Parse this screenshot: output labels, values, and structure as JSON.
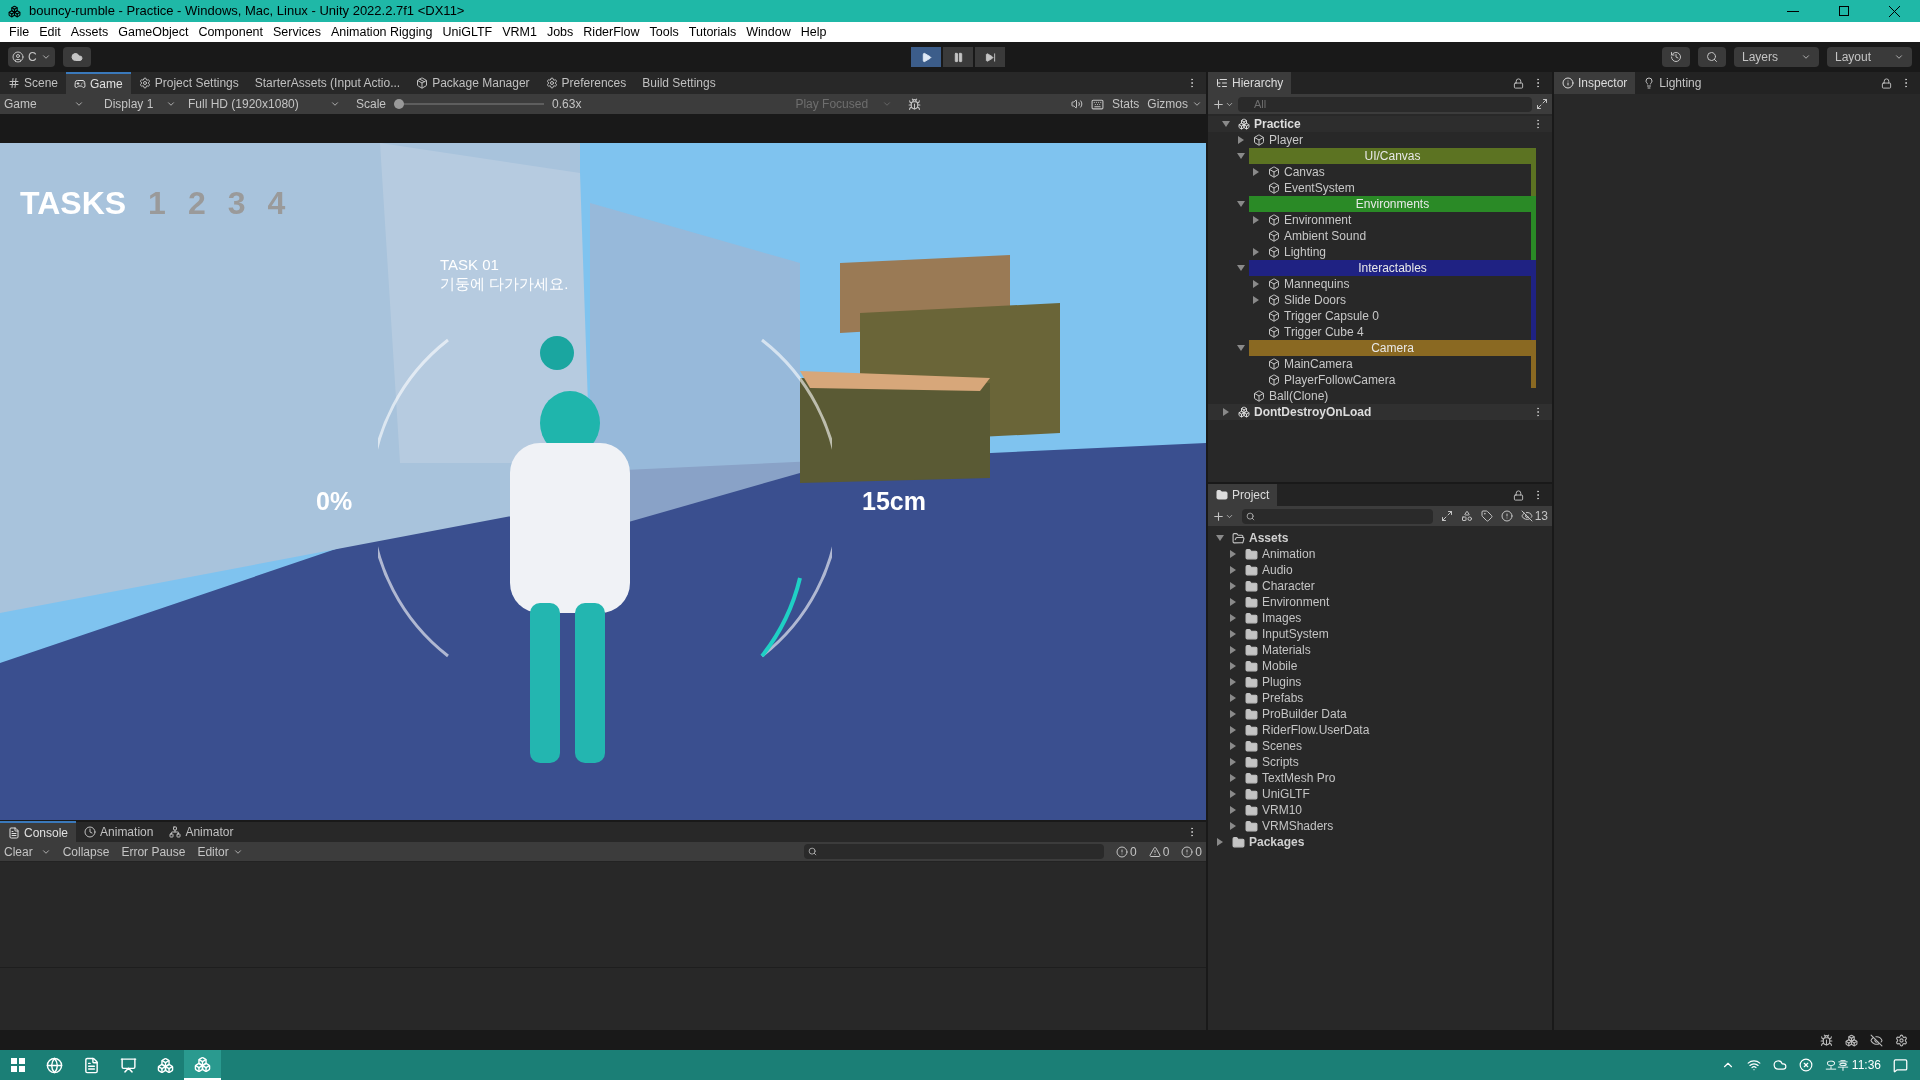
{
  "window": {
    "title": "bouncy-rumble - Practice - Windows, Mac, Linux - Unity 2022.2.7f1 <DX11>"
  },
  "menu": [
    "File",
    "Edit",
    "Assets",
    "GameObject",
    "Component",
    "Services",
    "Animation Rigging",
    "UniGLTF",
    "VRM1",
    "Jobs",
    "RiderFlow",
    "Tools",
    "Tutorials",
    "Window",
    "Help"
  ],
  "toolbar": {
    "account": "C",
    "play": [
      {
        "kind": "play",
        "on": true
      },
      {
        "kind": "pause",
        "on": false
      },
      {
        "kind": "step",
        "on": false
      }
    ],
    "layers": "Layers",
    "layout": "Layout"
  },
  "main_tabs": [
    {
      "label": "Scene",
      "selected": false
    },
    {
      "label": "Game",
      "selected": true
    },
    {
      "label": "Project Settings",
      "selected": false
    },
    {
      "label": "StarterAssets (Input Actio...",
      "selected": false
    },
    {
      "label": "Package Manager",
      "selected": false
    },
    {
      "label": "Preferences",
      "selected": false
    },
    {
      "label": "Build Settings",
      "selected": false
    }
  ],
  "game_toolbar": {
    "view": "Game",
    "display": "Display 1",
    "resolution": "Full HD (1920x1080)",
    "scale_label": "Scale",
    "scale": {
      "level": 0.0
    },
    "scale_value": "0.63x",
    "play_mode": {
      "label": "Play Focused",
      "disabled": true
    },
    "stats": "Stats",
    "gizmos": "Gizmos"
  },
  "game_hud": {
    "tasks_title": "TASKS",
    "tasks": [
      "1",
      "2",
      "3",
      "4"
    ],
    "task_heading": "TASK 01",
    "task_text": "기둥에 다가가세요.",
    "left_reading": "0%",
    "right_reading": "15cm"
  },
  "hierarchy": {
    "tab": "Hierarchy",
    "search_placeholder": "All",
    "items": [
      {
        "kind": "scene",
        "name": "Practice",
        "expanded": true,
        "children": [
          {
            "kind": "object",
            "name": "Player",
            "expanded": false
          },
          {
            "kind": "header",
            "name": "UI/Canvas",
            "color": "#5c7322",
            "expanded": true,
            "children": [
              {
                "kind": "object",
                "name": "Canvas",
                "expanded": false
              },
              {
                "kind": "object",
                "name": "EventSystem"
              }
            ]
          },
          {
            "kind": "header",
            "name": "Environments",
            "color": "#2a8a26",
            "expanded": true,
            "children": [
              {
                "kind": "object",
                "name": "Environment",
                "expanded": false
              },
              {
                "kind": "object",
                "name": "Ambient Sound"
              },
              {
                "kind": "object",
                "name": "Lighting",
                "expanded": false
              }
            ]
          },
          {
            "kind": "header",
            "name": "Interactables",
            "color": "#1f2283",
            "expanded": true,
            "children": [
              {
                "kind": "object",
                "name": "Mannequins",
                "expanded": false
              },
              {
                "kind": "object",
                "name": "Slide Doors",
                "expanded": false
              },
              {
                "kind": "object",
                "name": "Trigger Capsule 0"
              },
              {
                "kind": "object",
                "name": "Trigger Cube 4"
              }
            ]
          },
          {
            "kind": "header",
            "name": "Camera",
            "color": "#8a6922",
            "expanded": true,
            "children": [
              {
                "kind": "object",
                "name": "MainCamera"
              },
              {
                "kind": "object",
                "name": "PlayerFollowCamera"
              }
            ]
          },
          {
            "kind": "object",
            "name": "Ball(Clone)"
          }
        ]
      },
      {
        "kind": "scene",
        "name": "DontDestroyOnLoad",
        "expanded": false
      }
    ]
  },
  "inspector_tabs": [
    {
      "label": "Inspector",
      "selected": true
    },
    {
      "label": "Lighting",
      "selected": false
    }
  ],
  "project": {
    "tab": "Project",
    "hidden_count": "13",
    "items": [
      {
        "name": "Assets",
        "expanded": true,
        "children": [
          {
            "name": "Animation",
            "expanded": false
          },
          {
            "name": "Audio",
            "expanded": false
          },
          {
            "name": "Character",
            "expanded": false
          },
          {
            "name": "Environment",
            "expanded": false
          },
          {
            "name": "Images",
            "expanded": false
          },
          {
            "name": "InputSystem",
            "expanded": false
          },
          {
            "name": "Materials",
            "expanded": false
          },
          {
            "name": "Mobile",
            "expanded": false
          },
          {
            "name": "Plugins",
            "expanded": false
          },
          {
            "name": "Prefabs",
            "expanded": false
          },
          {
            "name": "ProBuilder Data",
            "expanded": false
          },
          {
            "name": "RiderFlow.UserData",
            "expanded": false
          },
          {
            "name": "Scenes",
            "expanded": false
          },
          {
            "name": "Scripts",
            "expanded": false
          },
          {
            "name": "TextMesh Pro",
            "expanded": false
          },
          {
            "name": "UniGLTF",
            "expanded": false
          },
          {
            "name": "VRM10",
            "expanded": false
          },
          {
            "name": "VRMShaders",
            "expanded": false
          }
        ]
      },
      {
        "name": "Packages",
        "expanded": false
      }
    ]
  },
  "console": {
    "tabs": [
      {
        "label": "Console",
        "selected": true
      },
      {
        "label": "Animation",
        "selected": false
      },
      {
        "label": "Animator",
        "selected": false
      }
    ],
    "clear": "Clear",
    "collapse": "Collapse",
    "error_pause": "Error Pause",
    "editor": "Editor",
    "counts": [
      "0",
      "0",
      "0"
    ]
  },
  "taskbar": {
    "time": "오후 11:36"
  }
}
